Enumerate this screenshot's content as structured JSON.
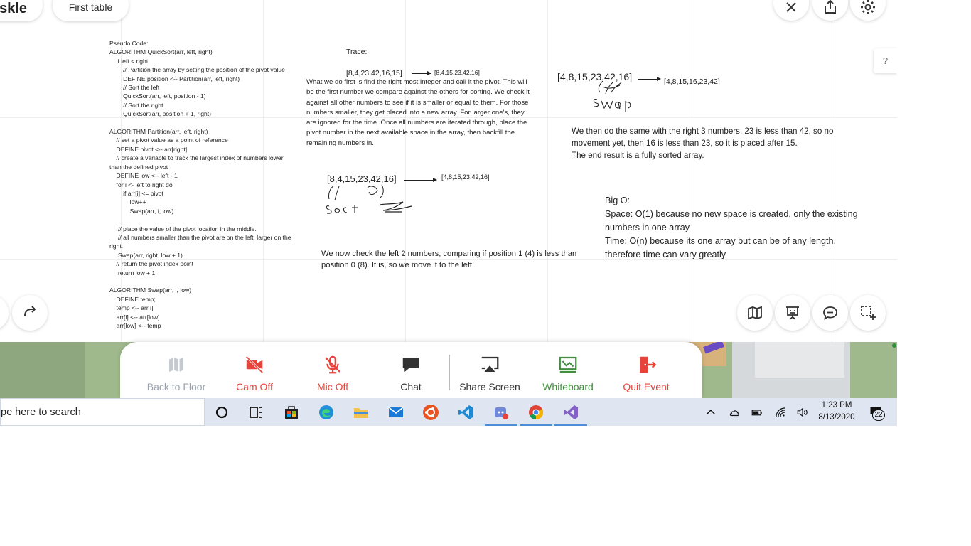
{
  "header": {
    "room_title_fragment": "skle",
    "table_name": "First table"
  },
  "help_label": "?",
  "notes": {
    "pseudo_code": "Pseudo Code:\nALGORITHM QuickSort(arr, left, right)\n    if left < right\n        // Partition the array by setting the position of the pivot value\n        DEFINE position <-- Partition(arr, left, right)\n        // Sort the left\n        QuickSort(arr, left, position - 1)\n        // Sort the right\n        QuickSort(arr, position + 1, right)\n\nALGORITHM Partition(arr, left, right)\n    // set a pivot value as a point of reference\n    DEFINE pivot <-- arr[right]\n    // create a variable to track the largest index of numbers lower\nthan the defined pivot\n    DEFINE low <-- left - 1\n    for i <- left to right do\n        if arr[i] <= pivot\n            low++\n            Swap(arr, i, low)\n\n     // place the value of the pivot location in the middle.\n     // all numbers smaller than the pivot are on the left, larger on the\nright.\n     Swap(arr, right, low + 1)\n    // return the pivot index point\n     return low + 1\n\nALGORITHM Swap(arr, i, low)\n    DEFINE temp;\n    temp <-- arr[i]\n    arr[i] <-- arr[low]\n    arr[low] <-- temp",
    "trace_label": "Trace:",
    "trace1_input": "[8,4,23,42,16,15]",
    "trace1_output": "[8,4,15,23,42,16]",
    "trace1_text": "What we do first is find the right most integer and call it the pivot. This will be the first number we compare against the others for sorting. We check it against all other numbers to see if it is smaller or equal to them. For those numbers smaller, they get placed into a new array. For larger one's, they are ignored for the time. Once all numbers are iterated through, place the pivot number in the next available space in the array, then backfill the remaining numbers in.",
    "trace2_input": "[8,4,15,23,42,16]",
    "trace2_output": "[4,8,15,23,42,16]",
    "trace2_scribble": "Sort",
    "trace2_text": "We now check the left 2 numbers, comparing if position 1 (4) is less than position 0 (8). It is, so we move it to the left.",
    "trace3_input": "[4,8,15,23,42,16]",
    "trace3_output": "[4,8,15,16,23,42]",
    "trace3_scribble": "swap",
    "trace3_text": "We then do the same with the right 3 numbers. 23 is less than 42, so no movement yet, then 16 is less than 23, so it is placed after 15.\nThe end result is a fully sorted array.",
    "bigo_title": "Big O:",
    "bigo_space": "Space: O(1) because no new space is created, only the existing numbers in one array",
    "bigo_time": "Time: O(n) because its one array but can be of any length, therefore time can vary greatly"
  },
  "toolbar": {
    "back_to_floor": "Back to Floor",
    "cam_off": "Cam Off",
    "mic_off": "Mic Off",
    "chat": "Chat",
    "share_screen": "Share Screen",
    "whiteboard": "Whiteboard",
    "quit_event": "Quit Event"
  },
  "taskbar": {
    "search_placeholder": "pe here to search",
    "time": "1:23 PM",
    "date": "8/13/2020",
    "notification_count": "22"
  },
  "colors": {
    "red": "#e8433a",
    "green": "#3f8f3c",
    "gray": "#9aa3ad",
    "dark": "#333333"
  }
}
